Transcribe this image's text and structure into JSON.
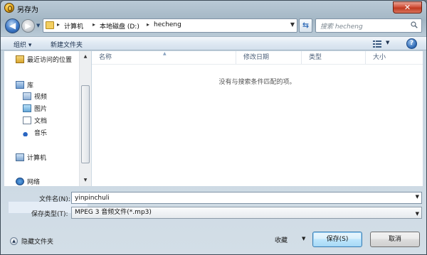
{
  "window": {
    "title": "另存为",
    "close_label": "✕"
  },
  "address": {
    "segments": [
      "计算机",
      "本地磁盘 (D:)",
      "hecheng"
    ]
  },
  "search": {
    "placeholder": "搜索 hecheng"
  },
  "toolbar": {
    "organize_label": "组织 ▾",
    "new_folder_label": "新建文件夹",
    "help_label": "?"
  },
  "nav": {
    "items": [
      {
        "label": "最近访问的位置",
        "icon": "recent-places-icon"
      },
      {
        "label": "库",
        "icon": "library-icon"
      },
      {
        "label": "视频",
        "icon": "video-icon"
      },
      {
        "label": "图片",
        "icon": "picture-icon"
      },
      {
        "label": "文档",
        "icon": "document-icon"
      },
      {
        "label": "音乐",
        "icon": "music-icon"
      },
      {
        "label": "计算机",
        "icon": "computer-icon"
      },
      {
        "label": "网络",
        "icon": "network-icon"
      }
    ]
  },
  "columns": [
    "名称",
    "修改日期",
    "类型",
    "大小"
  ],
  "content": {
    "empty_message": "没有与搜索条件匹配的项。"
  },
  "form": {
    "filename_label": "文件名(N):",
    "filename_value": "yinpinchuli",
    "filetype_label": "保存类型(T):",
    "filetype_value": "MPEG 3 音频文件(*.mp3)"
  },
  "footer": {
    "hide_folders_label": "隐藏文件夹",
    "tools_label": "收藏",
    "save_label": "保存(S)",
    "cancel_label": "取消"
  }
}
